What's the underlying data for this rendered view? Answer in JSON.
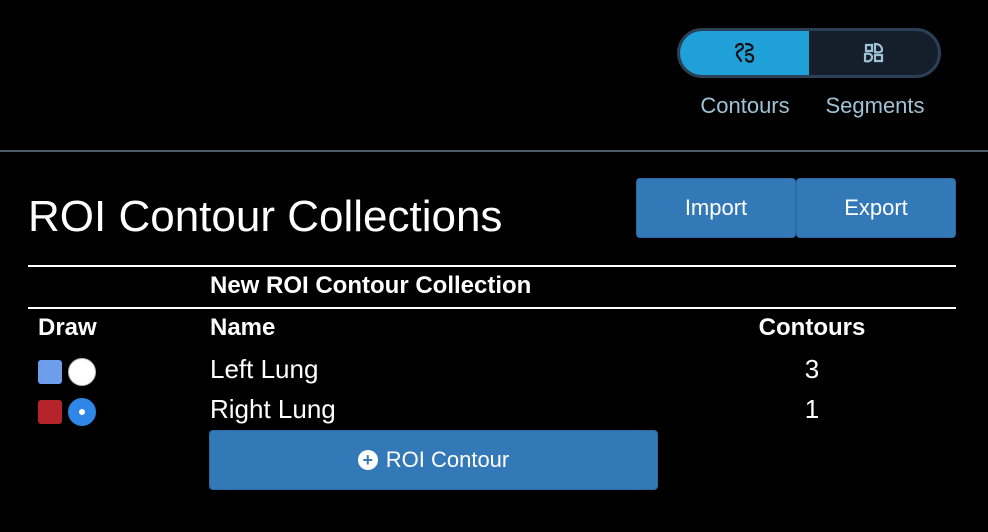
{
  "view_toggle": {
    "options": [
      {
        "label": "Contours",
        "icon": "contours-icon",
        "active": true
      },
      {
        "label": "Segments",
        "icon": "segments-icon",
        "active": false
      }
    ]
  },
  "panel": {
    "title": "ROI Contour Collections",
    "import_label": "Import",
    "export_label": "Export"
  },
  "collection": {
    "name": "New ROI Contour Collection",
    "columns": {
      "draw": "Draw",
      "name": "Name",
      "contours": "Contours"
    },
    "rows": [
      {
        "color": "#6d9eeb",
        "name": "Left Lung",
        "contours": "3",
        "selected": false
      },
      {
        "color": "#b5242a",
        "name": "Right Lung",
        "contours": "1",
        "selected": true
      }
    ],
    "add_label": "ROI Contour"
  },
  "colors": {
    "accent": "#3479b7",
    "toggle_active": "#20a0d8"
  }
}
